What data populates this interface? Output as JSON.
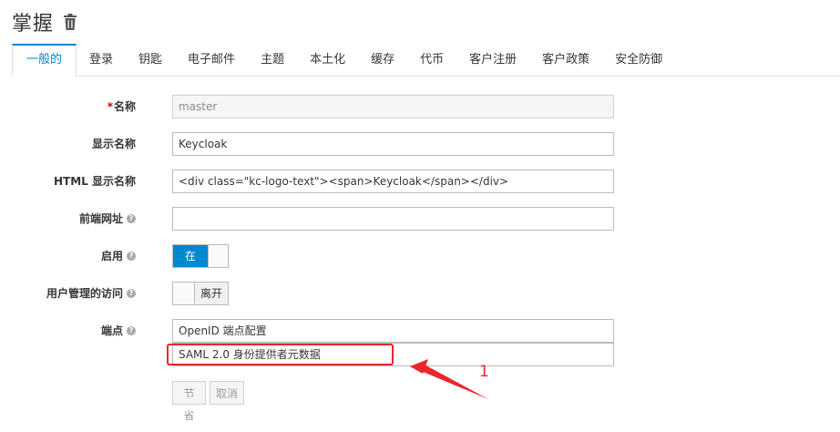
{
  "header": {
    "title": "掌握",
    "delete_icon": "trash-icon"
  },
  "tabs": [
    {
      "label": "一般的",
      "active": true
    },
    {
      "label": "登录"
    },
    {
      "label": "钥匙"
    },
    {
      "label": "电子邮件"
    },
    {
      "label": "主题"
    },
    {
      "label": "本土化"
    },
    {
      "label": "缓存"
    },
    {
      "label": "代币"
    },
    {
      "label": "客户注册"
    },
    {
      "label": "客户政策"
    },
    {
      "label": "安全防御"
    }
  ],
  "form": {
    "name": {
      "required_mark": "*",
      "label": "名称",
      "value": "master"
    },
    "display_name": {
      "label": "显示名称",
      "value": "Keycloak"
    },
    "html_display_name": {
      "label": "HTML 显示名称",
      "value": "<div class=\"kc-logo-text\"><span>Keycloak</span></div>"
    },
    "frontend_url": {
      "label": "前端网址",
      "value": ""
    },
    "enabled": {
      "label": "启用",
      "toggle_label": "在",
      "state": "on"
    },
    "user_managed_access": {
      "label": "用户管理的访问",
      "toggle_label": "离开",
      "state": "off"
    },
    "endpoints": {
      "label": "端点",
      "links": [
        "OpenID 端点配置",
        "SAML 2.0 身份提供者元数据"
      ]
    },
    "help_icon_glyph": "?"
  },
  "buttons": {
    "save": "节省",
    "cancel": "取消"
  },
  "annotation": {
    "number": "1",
    "color": "#e8262c"
  },
  "colors": {
    "accent": "#0088ce",
    "annotation": "#e8262c"
  }
}
